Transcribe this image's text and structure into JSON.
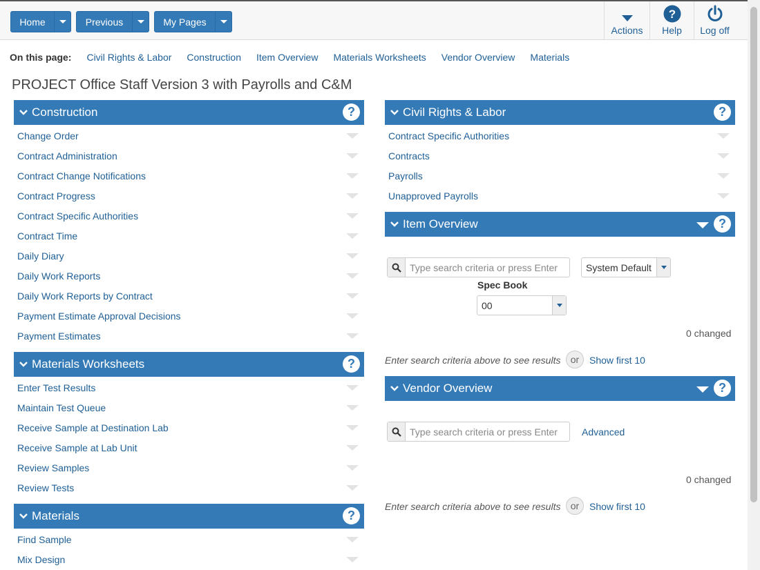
{
  "nav": {
    "home": "Home",
    "previous": "Previous",
    "my_pages": "My Pages"
  },
  "tools": {
    "actions": "Actions",
    "help": "Help",
    "logoff": "Log off"
  },
  "on_this_page": {
    "label": "On this page:",
    "links": [
      "Civil Rights & Labor",
      "Construction",
      "Item Overview",
      "Materials Worksheets",
      "Vendor Overview",
      "Materials"
    ]
  },
  "page_title": "PROJECT Office Staff Version 3 with Payrolls and C&M",
  "construction": {
    "title": "Construction",
    "items": [
      "Change Order",
      "Contract Administration",
      "Contract Change Notifications",
      "Contract Progress",
      "Contract Specific Authorities",
      "Contract Time",
      "Daily Diary",
      "Daily Work Reports",
      "Daily Work Reports by Contract",
      "Payment Estimate Approval Decisions",
      "Payment Estimates"
    ]
  },
  "materials_worksheets": {
    "title": "Materials Worksheets",
    "items": [
      "Enter Test Results",
      "Maintain Test Queue",
      "Receive Sample at Destination Lab",
      "Receive Sample at Lab Unit",
      "Review Samples",
      "Review Tests"
    ]
  },
  "materials": {
    "title": "Materials",
    "items": [
      "Find Sample",
      "Mix Design"
    ]
  },
  "civil_rights": {
    "title": "Civil Rights & Labor",
    "items": [
      "Contract Specific Authorities",
      "Contracts",
      "Payrolls",
      "Unapproved Payrolls"
    ]
  },
  "item_overview": {
    "title": "Item Overview",
    "search_placeholder": "Type search criteria or press Enter",
    "view_select": "System Default",
    "spec_book_label": "Spec Book",
    "spec_book_value": "00",
    "changed": "0 changed",
    "hint": "Enter search criteria above to see results",
    "or": "or",
    "show_first": "Show first 10"
  },
  "vendor_overview": {
    "title": "Vendor Overview",
    "search_placeholder": "Type search criteria or press Enter",
    "advanced": "Advanced",
    "changed": "0 changed",
    "hint": "Enter search criteria above to see results",
    "or": "or",
    "show_first": "Show first 10"
  },
  "colors": {
    "primary": "#337ab7",
    "link": "#1f5f96"
  }
}
